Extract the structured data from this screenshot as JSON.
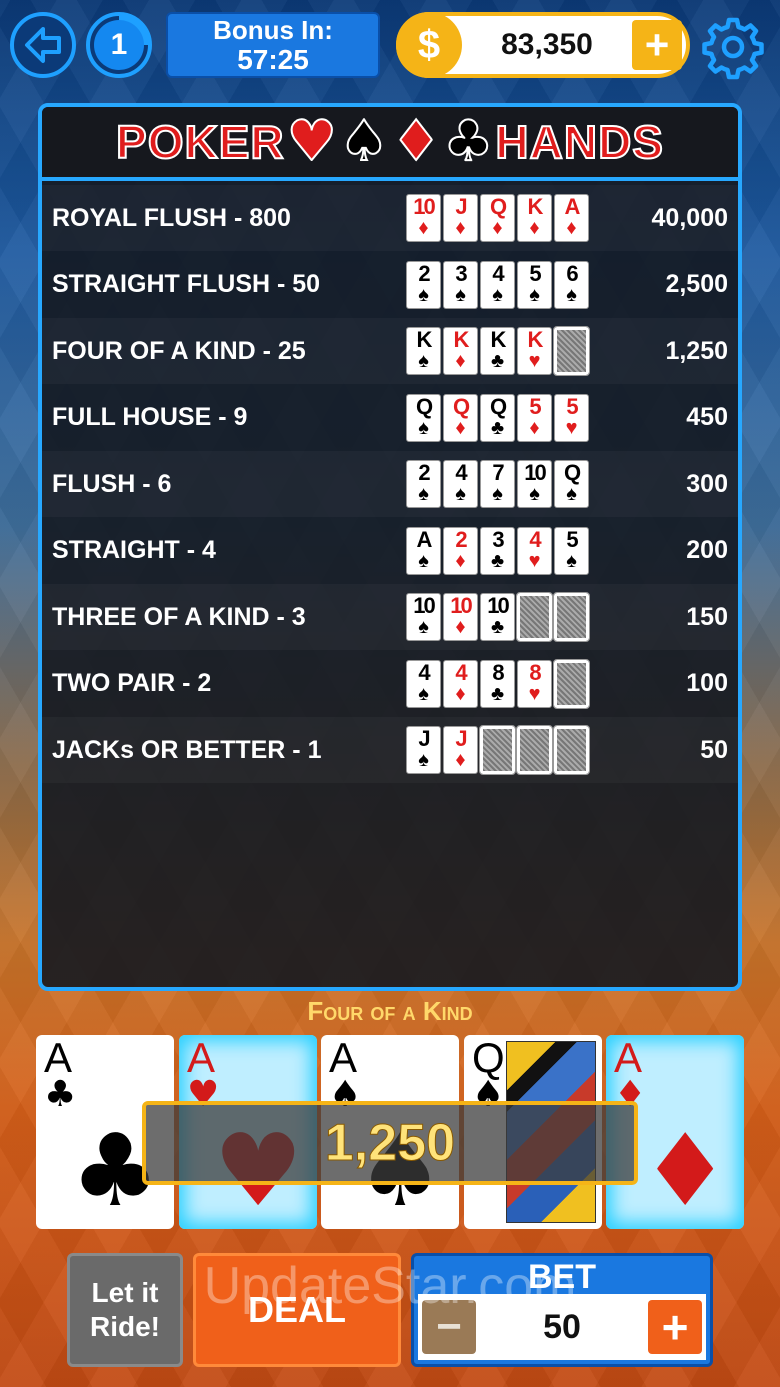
{
  "top_bar": {
    "back_icon": "back-arrow-icon",
    "level": "1",
    "bonus_label": "Bonus In:",
    "bonus_time": "57:25",
    "coin_symbol": "$",
    "coins": "83,350",
    "add_coins_label": "+",
    "settings_icon": "gear-icon"
  },
  "paytable": {
    "title_left": "POKER",
    "title_right": "HANDS",
    "suits": [
      {
        "glyph": "♥",
        "color": "red"
      },
      {
        "glyph": "♠",
        "color": "black"
      },
      {
        "glyph": "♦",
        "color": "red"
      },
      {
        "glyph": "♣",
        "color": "black"
      }
    ],
    "rows": [
      {
        "name": "ROYAL FLUSH - 800",
        "payout": "40,000",
        "cards": [
          {
            "r": "10",
            "s": "♦",
            "c": "red"
          },
          {
            "r": "J",
            "s": "♦",
            "c": "red"
          },
          {
            "r": "Q",
            "s": "♦",
            "c": "red"
          },
          {
            "r": "K",
            "s": "♦",
            "c": "red"
          },
          {
            "r": "A",
            "s": "♦",
            "c": "red"
          }
        ]
      },
      {
        "name": "STRAIGHT FLUSH - 50",
        "payout": "2,500",
        "cards": [
          {
            "r": "2",
            "s": "♠",
            "c": "black"
          },
          {
            "r": "3",
            "s": "♠",
            "c": "black"
          },
          {
            "r": "4",
            "s": "♠",
            "c": "black"
          },
          {
            "r": "5",
            "s": "♠",
            "c": "black"
          },
          {
            "r": "6",
            "s": "♠",
            "c": "black"
          }
        ]
      },
      {
        "name": "FOUR OF A KIND - 25",
        "payout": "1,250",
        "cards": [
          {
            "r": "K",
            "s": "♠",
            "c": "black"
          },
          {
            "r": "K",
            "s": "♦",
            "c": "red"
          },
          {
            "r": "K",
            "s": "♣",
            "c": "black"
          },
          {
            "r": "K",
            "s": "♥",
            "c": "red"
          },
          {
            "back": true
          }
        ]
      },
      {
        "name": "FULL HOUSE - 9",
        "payout": "450",
        "cards": [
          {
            "r": "Q",
            "s": "♠",
            "c": "black"
          },
          {
            "r": "Q",
            "s": "♦",
            "c": "red"
          },
          {
            "r": "Q",
            "s": "♣",
            "c": "black"
          },
          {
            "r": "5",
            "s": "♦",
            "c": "red"
          },
          {
            "r": "5",
            "s": "♥",
            "c": "red"
          }
        ]
      },
      {
        "name": "FLUSH - 6",
        "payout": "300",
        "cards": [
          {
            "r": "2",
            "s": "♠",
            "c": "black"
          },
          {
            "r": "4",
            "s": "♠",
            "c": "black"
          },
          {
            "r": "7",
            "s": "♠",
            "c": "black"
          },
          {
            "r": "10",
            "s": "♠",
            "c": "black"
          },
          {
            "r": "Q",
            "s": "♠",
            "c": "black"
          }
        ]
      },
      {
        "name": "STRAIGHT - 4",
        "payout": "200",
        "cards": [
          {
            "r": "A",
            "s": "♠",
            "c": "black"
          },
          {
            "r": "2",
            "s": "♦",
            "c": "red"
          },
          {
            "r": "3",
            "s": "♣",
            "c": "black"
          },
          {
            "r": "4",
            "s": "♥",
            "c": "red"
          },
          {
            "r": "5",
            "s": "♠",
            "c": "black"
          }
        ]
      },
      {
        "name": "THREE OF A KIND - 3",
        "payout": "150",
        "cards": [
          {
            "r": "10",
            "s": "♠",
            "c": "black"
          },
          {
            "r": "10",
            "s": "♦",
            "c": "red"
          },
          {
            "r": "10",
            "s": "♣",
            "c": "black"
          },
          {
            "back": true
          },
          {
            "back": true
          }
        ]
      },
      {
        "name": "TWO PAIR - 2",
        "payout": "100",
        "cards": [
          {
            "r": "4",
            "s": "♠",
            "c": "black"
          },
          {
            "r": "4",
            "s": "♦",
            "c": "red"
          },
          {
            "r": "8",
            "s": "♣",
            "c": "black"
          },
          {
            "r": "8",
            "s": "♥",
            "c": "red"
          },
          {
            "back": true
          }
        ]
      },
      {
        "name": "JACKs OR BETTER - 1",
        "payout": "50",
        "cards": [
          {
            "r": "J",
            "s": "♠",
            "c": "black"
          },
          {
            "r": "J",
            "s": "♦",
            "c": "red"
          },
          {
            "back": true
          },
          {
            "back": true
          },
          {
            "back": true
          }
        ]
      }
    ]
  },
  "result": {
    "hand_label": "Four of a Kind",
    "win_amount": "1,250",
    "cards": [
      {
        "rank": "A",
        "suit": "♣",
        "color": "black",
        "held": false
      },
      {
        "rank": "A",
        "suit": "♥",
        "color": "red",
        "held": true
      },
      {
        "rank": "A",
        "suit": "♠",
        "color": "black",
        "held": false
      },
      {
        "rank": "Q",
        "suit": "♠",
        "color": "black",
        "held": false,
        "face": true
      },
      {
        "rank": "A",
        "suit": "♦",
        "color": "red",
        "held": true
      }
    ]
  },
  "controls": {
    "let_it_ride": "Let it Ride!",
    "deal": "DEAL",
    "bet_label": "BET",
    "bet_value": "50",
    "minus": "−",
    "plus": "+"
  },
  "watermark": "UpdateStar.com"
}
